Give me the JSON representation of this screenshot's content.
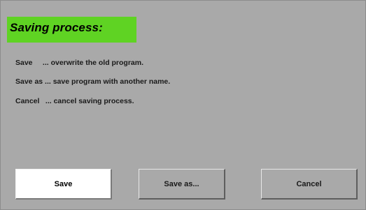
{
  "dialog": {
    "title": "Saving process:",
    "lines": [
      {
        "key": "Save",
        "text": "... overwrite the old program."
      },
      {
        "key": "Save as",
        "text": "... save program with another name."
      },
      {
        "key": "Cancel",
        "text": "... cancel saving process."
      }
    ],
    "buttons": {
      "save": "Save",
      "save_as": "Save as...",
      "cancel": "Cancel"
    }
  },
  "colors": {
    "title_bg": "#5fd323",
    "dialog_bg": "#a9a9a9",
    "primary_button_bg": "#ffffff"
  }
}
